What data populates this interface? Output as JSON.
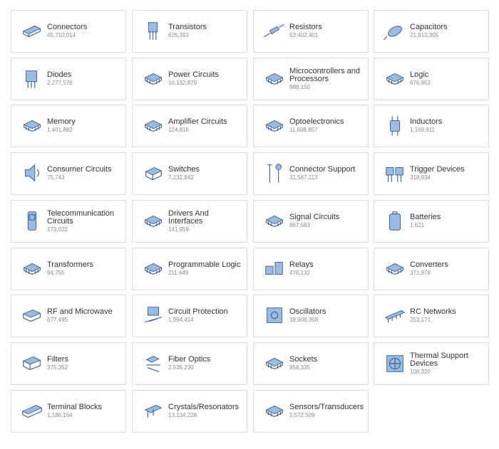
{
  "categories": [
    {
      "name": "Connectors",
      "count": "45,710,014",
      "icon": "connector-icon"
    },
    {
      "name": "Transistors",
      "count": "626,393",
      "icon": "transistor-icon"
    },
    {
      "name": "Resistors",
      "count": "53,402,401",
      "icon": "resistor-icon"
    },
    {
      "name": "Capacitors",
      "count": "21,913,305",
      "icon": "capacitor-icon"
    },
    {
      "name": "Diodes",
      "count": "2,277,576",
      "icon": "diode-icon"
    },
    {
      "name": "Power Circuits",
      "count": "10,132,879",
      "icon": "power-circuit-icon"
    },
    {
      "name": "Microcontrollers and Processors",
      "count": "888,150",
      "icon": "microcontroller-icon"
    },
    {
      "name": "Logic",
      "count": "676,953",
      "icon": "logic-chip-icon"
    },
    {
      "name": "Memory",
      "count": "1,401,882",
      "icon": "memory-chip-icon"
    },
    {
      "name": "Amplifier Circuits",
      "count": "124,816",
      "icon": "amplifier-chip-icon"
    },
    {
      "name": "Optoelectronics",
      "count": "11,608,857",
      "icon": "optoelectronics-icon"
    },
    {
      "name": "Inductors",
      "count": "1,169,911",
      "icon": "inductor-icon"
    },
    {
      "name": "Consumer Circuits",
      "count": "75,743",
      "icon": "speaker-icon"
    },
    {
      "name": "Switches",
      "count": "7,232,842",
      "icon": "switch-icon"
    },
    {
      "name": "Connector Support",
      "count": "31,587,113",
      "icon": "tools-icon"
    },
    {
      "name": "Trigger Devices",
      "count": "318,934",
      "icon": "trigger-device-icon"
    },
    {
      "name": "Telecommunication Circuits",
      "count": "173,022",
      "icon": "phone-icon"
    },
    {
      "name": "Drivers And Interfaces",
      "count": "141,959",
      "icon": "driver-chip-icon"
    },
    {
      "name": "Signal Circuits",
      "count": "867,583",
      "icon": "signal-chip-icon"
    },
    {
      "name": "Batteries",
      "count": "1,621",
      "icon": "battery-icon"
    },
    {
      "name": "Transformers",
      "count": "94,755",
      "icon": "transformer-icon"
    },
    {
      "name": "Programmable Logic",
      "count": "211,649",
      "icon": "programmable-logic-icon"
    },
    {
      "name": "Relays",
      "count": "476,132",
      "icon": "relay-icon"
    },
    {
      "name": "Converters",
      "count": "371,978",
      "icon": "converter-icon"
    },
    {
      "name": "RF and Microwave",
      "count": "677,495",
      "icon": "rf-module-icon"
    },
    {
      "name": "Circuit Protection",
      "count": "1,994,414",
      "icon": "fuse-icon"
    },
    {
      "name": "Oscillators",
      "count": "18,908,358",
      "icon": "oscillator-icon"
    },
    {
      "name": "RC Networks",
      "count": "253,171",
      "icon": "rc-network-icon"
    },
    {
      "name": "Filters",
      "count": "375,352",
      "icon": "filter-icon"
    },
    {
      "name": "Fiber Optics",
      "count": "2,535,230",
      "icon": "fiber-optic-icon"
    },
    {
      "name": "Sockets",
      "count": "958,335",
      "icon": "socket-icon"
    },
    {
      "name": "Thermal Support Devices",
      "count": "108,320",
      "icon": "fan-icon"
    },
    {
      "name": "Terminal Blocks",
      "count": "1,186,164",
      "icon": "terminal-block-icon"
    },
    {
      "name": "Crystals/Resonators",
      "count": "13,134,228",
      "icon": "crystal-icon"
    },
    {
      "name": "Sensors/Transducers",
      "count": "5,572,509",
      "icon": "sensor-chip-icon"
    }
  ]
}
